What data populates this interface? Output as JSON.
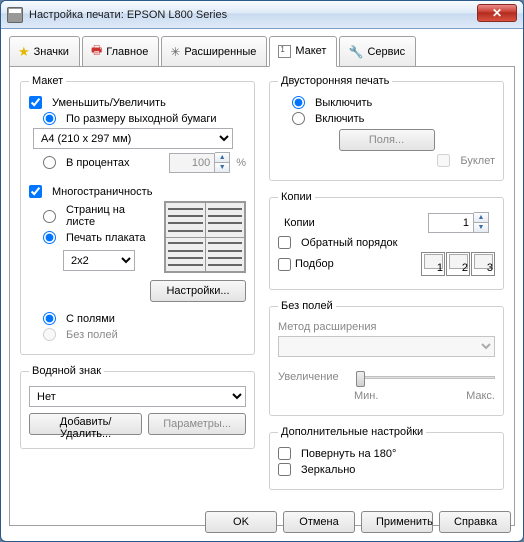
{
  "title": "Настройка печати: EPSON L800 Series",
  "tabs": {
    "icons": "Значки",
    "main": "Главное",
    "advanced": "Расширенные",
    "layout": "Макет",
    "service": "Сервис"
  },
  "layout": {
    "group": "Макет",
    "reduce_enlarge": "Уменьшить/Увеличить",
    "fit_to_page": "По размеру выходной бумаги",
    "paper_size": "A4 (210 x 297 мм)",
    "by_percent": "В процентах",
    "percent_value": "100",
    "percent_sym": "%",
    "multipage": "Многостраничность",
    "pages_per_sheet": "Страниц на листе",
    "poster": "Печать плаката",
    "poster_size": "2x2",
    "settings_btn": "Настройки...",
    "with_margins": "С полями",
    "no_margins": "Без полей"
  },
  "watermark": {
    "group": "Водяной знак",
    "value": "Нет",
    "add_remove": "Добавить/Удалить...",
    "params": "Параметры..."
  },
  "duplex": {
    "group": "Двусторонняя печать",
    "off": "Выключить",
    "on": "Включить",
    "margins_btn": "Поля...",
    "booklet": "Буклет"
  },
  "copies": {
    "group": "Копии",
    "label": "Копии",
    "value": "1",
    "reverse": "Обратный порядок",
    "collate": "Подбор",
    "c1": "1",
    "c2": "2",
    "c3": "3"
  },
  "borderless": {
    "group": "Без полей",
    "method": "Метод расширения",
    "enlarge": "Увеличение",
    "min": "Мин.",
    "max": "Макс."
  },
  "extra": {
    "group": "Дополнительные настройки",
    "rotate": "Повернуть на  180°",
    "mirror": "Зеркально"
  },
  "buttons": {
    "ok": "OK",
    "cancel": "Отмена",
    "apply": "Применить",
    "help": "Справка"
  }
}
